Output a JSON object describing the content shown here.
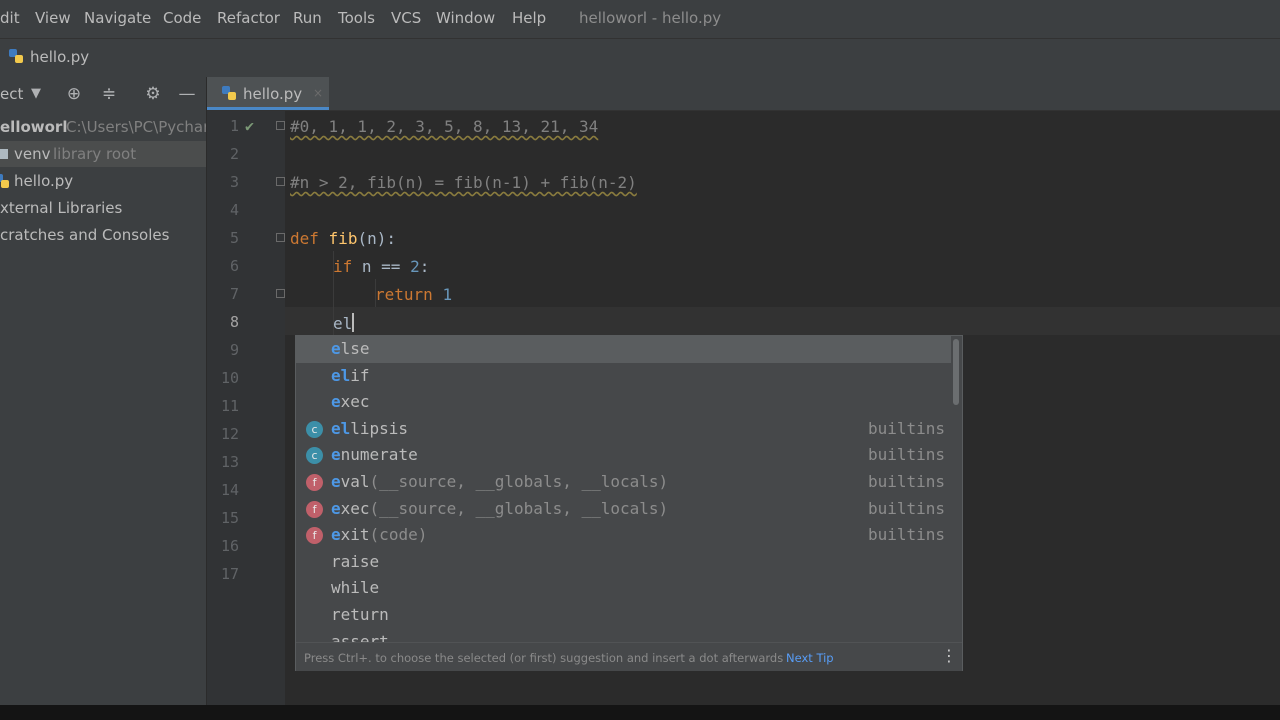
{
  "menu": [
    "dit",
    "View",
    "Navigate",
    "Code",
    "Refactor",
    "Run",
    "Tools",
    "VCS",
    "Window",
    "Help"
  ],
  "window_title": "helloworl - hello.py",
  "navbar": {
    "file": "hello.py"
  },
  "project": {
    "header_label": "ect",
    "tree": [
      {
        "name": "elloworl",
        "extra": "C:\\Users\\PC\\Pychar"
      },
      {
        "name": "venv",
        "extra": "library root"
      },
      {
        "name": "hello.py",
        "extra": ""
      },
      {
        "name": "xternal Libraries",
        "extra": ""
      },
      {
        "name": "cratches and Consoles",
        "extra": ""
      }
    ]
  },
  "tab": {
    "label": "hello.py",
    "close": "×"
  },
  "editor": {
    "line_numbers": [
      "1",
      "2",
      "3",
      "4",
      "5",
      "6",
      "7",
      "8",
      "9",
      "10",
      "11",
      "12",
      "13",
      "14",
      "15",
      "16",
      "17"
    ],
    "current_line": "8",
    "line1": "#0, 1, 1, 2, 3, 5, 8, 13, 21, 34",
    "line3": "#n > 2, fib(n) = fib(n-1) + fib(n-2)",
    "line5": {
      "kw": "def",
      "fn": "fib",
      "rest": "(n):"
    },
    "line6": {
      "kw": "if",
      "rest": " n == ",
      "num": "2",
      "end": ":"
    },
    "line7": {
      "kw": "return",
      "num": "1"
    },
    "line8": "el"
  },
  "completion": {
    "items": [
      {
        "match": "e",
        "rest": "lse",
        "args": "",
        "source": "",
        "icon": ""
      },
      {
        "match": "el",
        "rest": "if",
        "args": "",
        "source": "",
        "icon": ""
      },
      {
        "match": "e",
        "rest": "xec",
        "args": "",
        "source": "",
        "icon": ""
      },
      {
        "match": "el",
        "rest": "lipsis",
        "args": "",
        "source": "builtins",
        "icon": "c"
      },
      {
        "match": "e",
        "rest": "numerate",
        "args": "",
        "source": "builtins",
        "icon": "c"
      },
      {
        "match": "e",
        "rest": "val",
        "args": "(__source, __globals, __locals)",
        "source": "builtins",
        "icon": "f"
      },
      {
        "match": "e",
        "rest": "xec",
        "args": "(__source, __globals, __locals)",
        "source": "builtins",
        "icon": "f"
      },
      {
        "match": "e",
        "rest": "xit",
        "args": "(code)",
        "source": "builtins",
        "icon": "f"
      },
      {
        "match": "",
        "rest": "raise",
        "args": "",
        "source": "",
        "icon": ""
      },
      {
        "match": "",
        "rest": "while",
        "args": "",
        "source": "",
        "icon": ""
      },
      {
        "match": "",
        "rest": "return",
        "args": "",
        "source": "",
        "icon": ""
      },
      {
        "match": "",
        "rest": "assert",
        "args": "",
        "source": "",
        "icon": ""
      }
    ],
    "footer_hint": "Press Ctrl+. to choose the selected (or first) suggestion and insert a dot afterwards",
    "next_tip": "Next Tip",
    "more": "⋮"
  },
  "colors": {
    "accent": "#4a88c7",
    "keyword": "#cc7832",
    "function": "#ffc66d",
    "number": "#6897bb"
  }
}
